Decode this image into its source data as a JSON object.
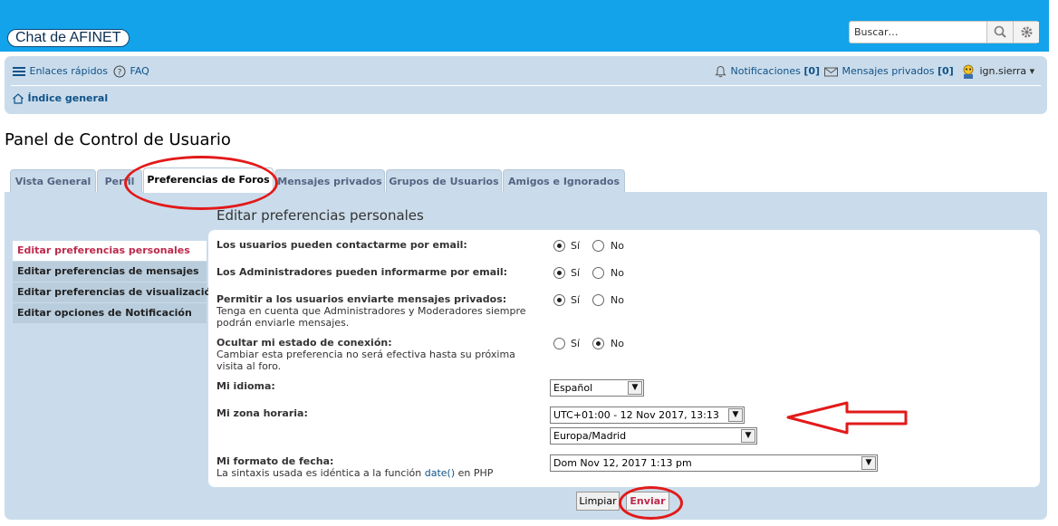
{
  "header": {
    "site_title": "Chat de AFINET",
    "search_placeholder": "Buscar…"
  },
  "navbar": {
    "quick_links": "Enlaces rápidos",
    "faq": "FAQ",
    "notifications_label": "Notificaciones",
    "notifications_count": "[0]",
    "private_messages_label": "Mensajes privados",
    "private_messages_count": "[0]",
    "username": "ign.sierra",
    "breadcrumb": "Índice general"
  },
  "page_title": "Panel de Control de Usuario",
  "tabs": [
    {
      "label": "Vista General"
    },
    {
      "label": "Perfil"
    },
    {
      "label": "Preferencias de Foros"
    },
    {
      "label": "Mensajes privados"
    },
    {
      "label": "Grupos de Usuarios"
    },
    {
      "label": "Amigos e Ignorados"
    }
  ],
  "panel_heading": "Editar preferencias personales",
  "sidebar": [
    {
      "label": "Editar preferencias personales"
    },
    {
      "label": "Editar preferencias de mensajes"
    },
    {
      "label": "Editar preferencias de visualización"
    },
    {
      "label": "Editar opciones de Notificación"
    }
  ],
  "options": {
    "yes": "Sí",
    "no": "No"
  },
  "form": {
    "allow_email": {
      "label": "Los usuarios pueden contactarme por email:",
      "value": "Sí"
    },
    "admin_email": {
      "label": "Los Administradores pueden informarme por email:",
      "value": "Sí"
    },
    "allow_pm": {
      "label": "Permitir a los usuarios enviarte mensajes privados:",
      "desc": "Tenga en cuenta que Administradores y Moderadores siempre podrán enviarle mensajes.",
      "value": "Sí"
    },
    "hide_online": {
      "label": "Ocultar mi estado de conexión:",
      "desc": "Cambiar esta preferencia no será efectiva hasta su próxima visita al foro.",
      "value": "No"
    },
    "language": {
      "label": "Mi idioma:",
      "value": "Español"
    },
    "timezone": {
      "label": "Mi zona horaria:",
      "offset_value": "UTC+01:00 - 12 Nov 2017, 13:13",
      "zone_value": "Europa/Madrid"
    },
    "date_format": {
      "label": "Mi formato de fecha:",
      "desc_before": "La sintaxis usada es idéntica a la función",
      "desc_link": "date()",
      "desc_after": "en PHP",
      "value": "Dom Nov 12, 2017 1:13 pm"
    }
  },
  "buttons": {
    "reset": "Limpiar",
    "submit": "Enviar"
  },
  "colors": {
    "header": "#12a3eb",
    "panel": "#cadceb",
    "active_link": "#bc2a4d",
    "annotation": "#e21a1a"
  }
}
